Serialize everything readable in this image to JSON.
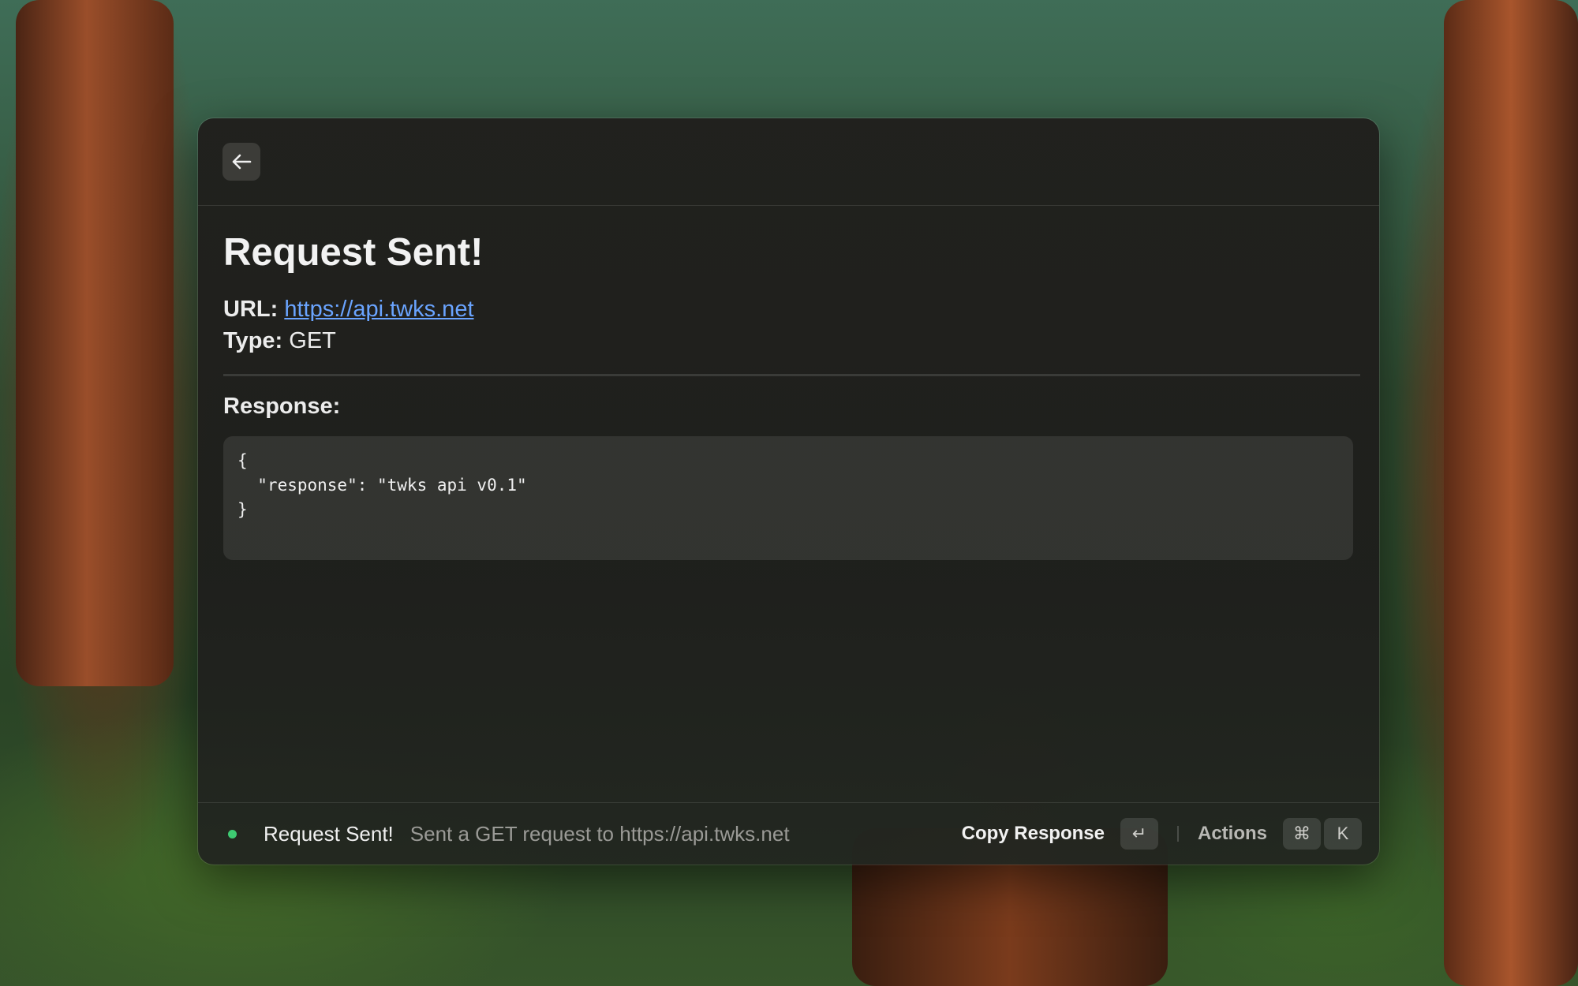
{
  "header": {
    "back_icon": "arrow-left-icon"
  },
  "main": {
    "title": "Request Sent!",
    "url_label": "URL:",
    "url_value": "https://api.twks.net",
    "type_label": "Type:",
    "type_value": "GET",
    "response_label": "Response:",
    "response_lines": [
      "{",
      "  \"response\": \"twks api v0.1\"",
      "}"
    ]
  },
  "footer": {
    "status_color": "#3ecb72",
    "status_title": "Request Sent!",
    "status_subtitle": "Sent a GET request to https://api.twks.net",
    "primary_action": "Copy Response",
    "primary_shortcut": "↵",
    "actions_label": "Actions",
    "actions_shortcut": [
      "⌘",
      "K"
    ]
  }
}
